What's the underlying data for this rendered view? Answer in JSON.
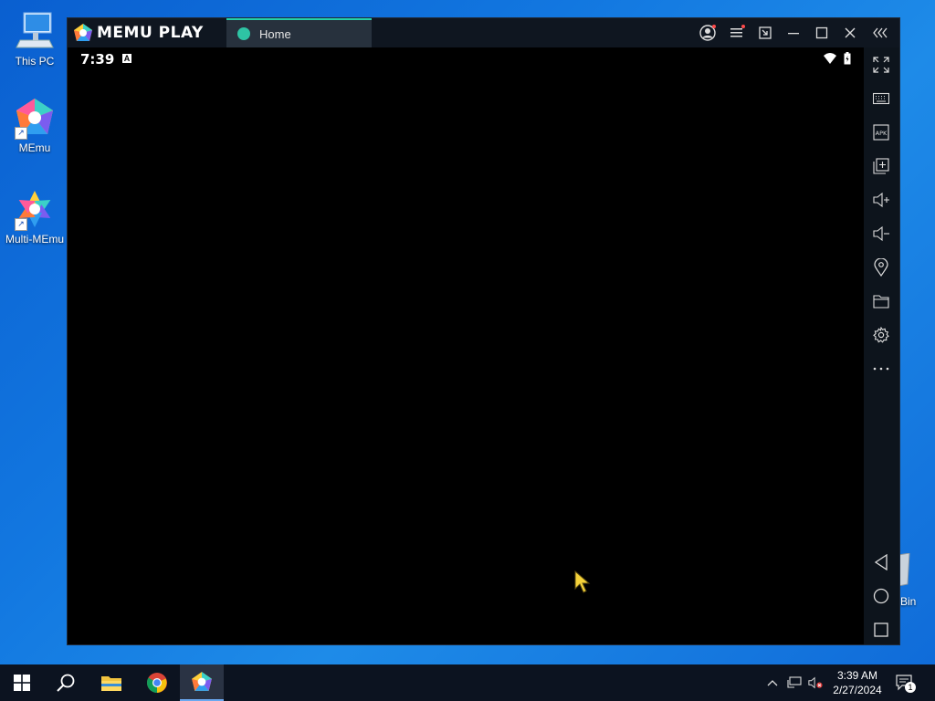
{
  "desktop": {
    "icons": [
      {
        "label": "This PC"
      },
      {
        "label": "MEmu"
      },
      {
        "label": "Multi-MEmu"
      }
    ],
    "recycle_bin_partial_label": "Bin"
  },
  "window": {
    "app_name": "MEMU PLAY",
    "tab_label": "Home",
    "accent_color": "#24d0a8"
  },
  "android": {
    "time": "7:39",
    "notification_icon": "A"
  },
  "sidebar": {
    "tools": [
      "fullscreen",
      "keyboard-mapping",
      "install-apk",
      "multi-instance",
      "volume-up",
      "volume-down",
      "location",
      "shared-folder",
      "settings",
      "more"
    ],
    "nav": [
      "back",
      "home",
      "recents"
    ]
  },
  "taskbar": {
    "time": "3:39 AM",
    "date": "2/27/2024",
    "notification_count": "1"
  }
}
